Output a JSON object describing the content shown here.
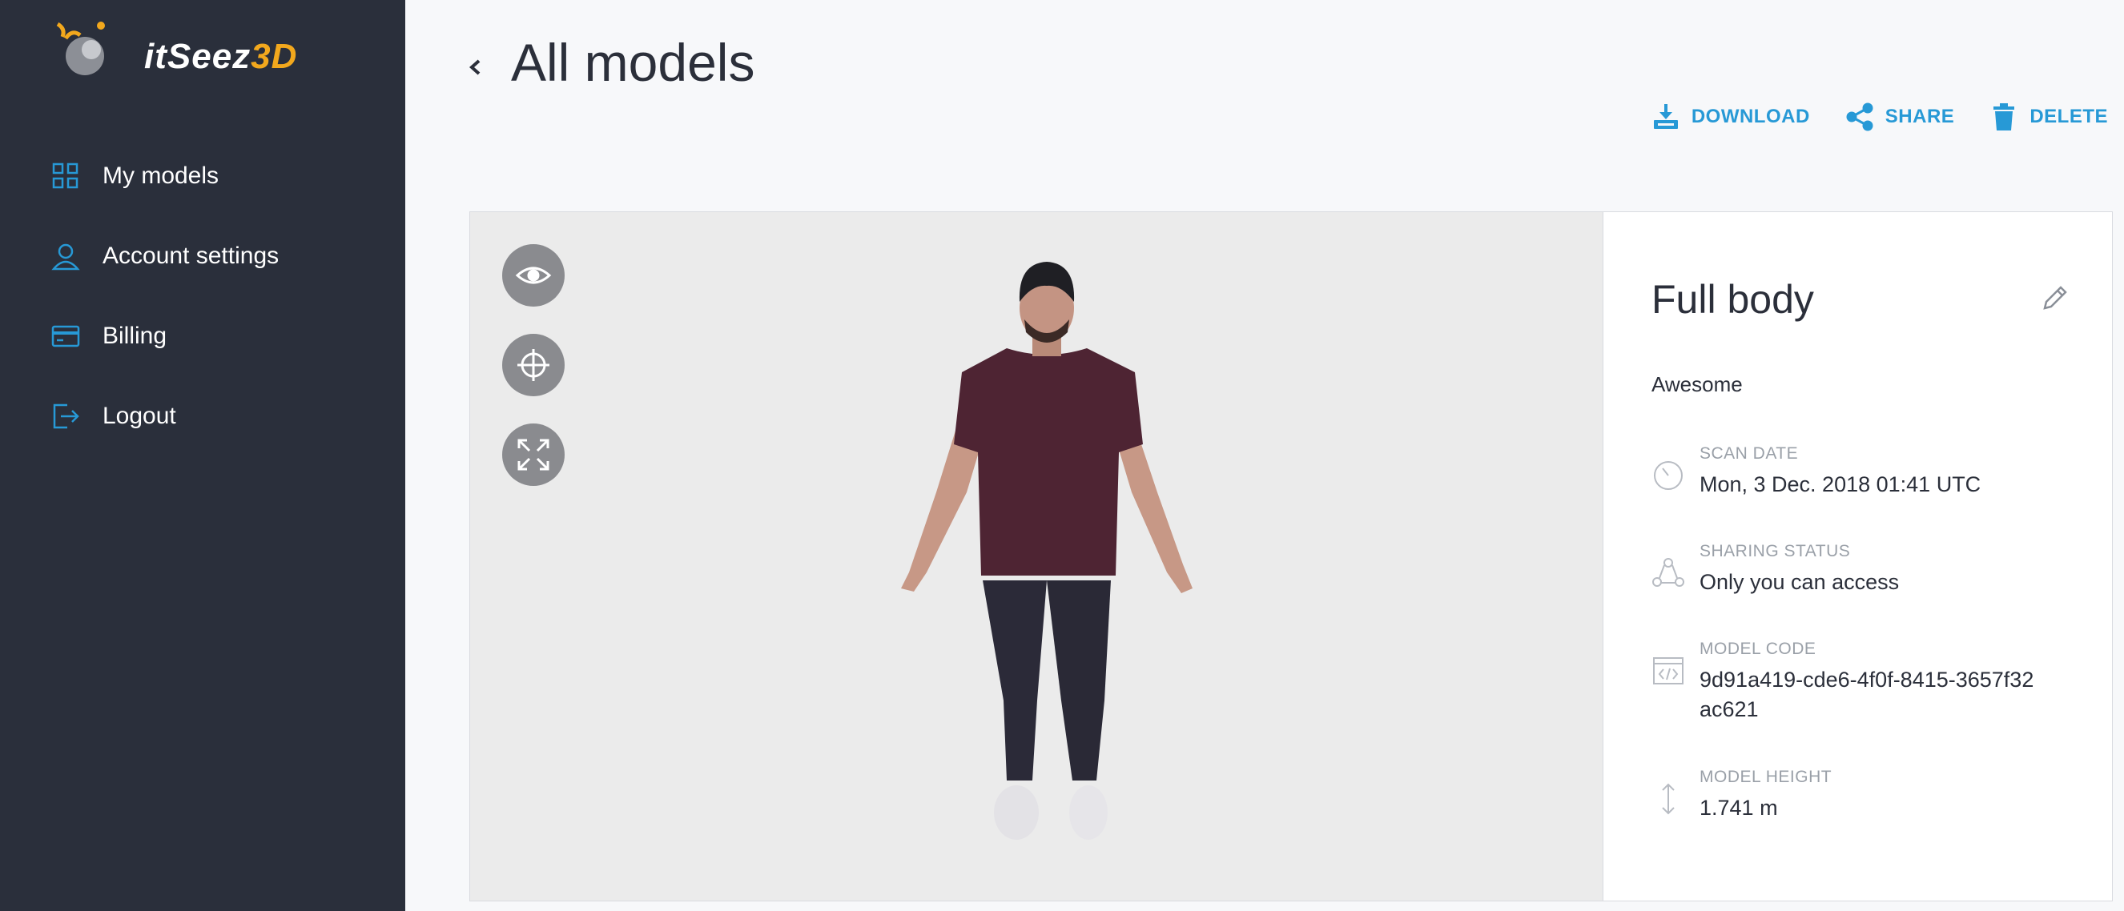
{
  "brand": {
    "name_main": "itSeez",
    "name_accent": "3D"
  },
  "sidebar": {
    "items": [
      {
        "label": "My models",
        "icon": "grid-icon"
      },
      {
        "label": "Account settings",
        "icon": "user-icon"
      },
      {
        "label": "Billing",
        "icon": "credit-card-icon"
      },
      {
        "label": "Logout",
        "icon": "logout-icon"
      }
    ]
  },
  "header": {
    "title": "All models",
    "actions": {
      "download": "DOWNLOAD",
      "share": "SHARE",
      "delete": "DELETE"
    }
  },
  "viewer": {
    "tools": [
      "eye-icon",
      "move-icon",
      "fullscreen-icon"
    ]
  },
  "model": {
    "name": "Full body",
    "description": "Awesome",
    "fields": {
      "scan_date": {
        "label": "SCAN DATE",
        "value": "Mon, 3 Dec. 2018 01:41 UTC"
      },
      "sharing_status": {
        "label": "SHARING STATUS",
        "value": "Only you can access"
      },
      "model_code": {
        "label": "MODEL CODE",
        "value": "9d91a419-cde6-4f0f-8415-3657f32ac621"
      },
      "model_height": {
        "label": "MODEL HEIGHT",
        "value": "1.741 m"
      }
    }
  },
  "colors": {
    "accent": "#2799d6",
    "sidebar": "#2a2f3b",
    "logo_accent": "#f2a81d"
  }
}
